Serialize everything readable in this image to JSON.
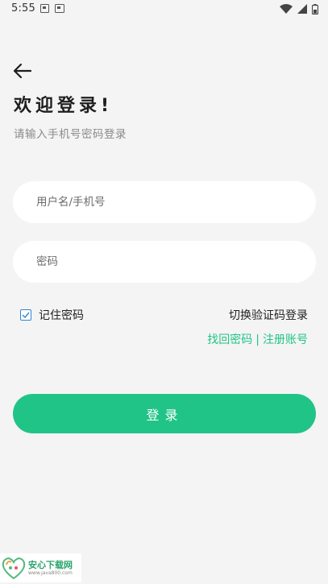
{
  "status_bar": {
    "time": "5:55",
    "icons": [
      "photo-notification-icon",
      "gallery-notification-icon",
      "wifi-icon",
      "signal-icon",
      "battery-icon"
    ]
  },
  "header": {
    "back_icon": "arrow-left-icon",
    "title": "欢迎登录!",
    "subtitle": "请输入手机号密码登录"
  },
  "form": {
    "username_placeholder": "用户名/手机号",
    "username_value": "",
    "password_placeholder": "密码",
    "password_value": "",
    "remember_label": "记住密码",
    "remember_checked": true,
    "switch_label": "切换验证码登录",
    "find_password_label": "找回密码",
    "separator": "|",
    "register_label": "注册账号",
    "login_button_label": "登录"
  },
  "watermark": {
    "title": "安心下载网",
    "url": "www.java800.com"
  },
  "colors": {
    "accent": "#21c487",
    "background": "#f4f4f4",
    "checkbox": "#2f86d6"
  }
}
